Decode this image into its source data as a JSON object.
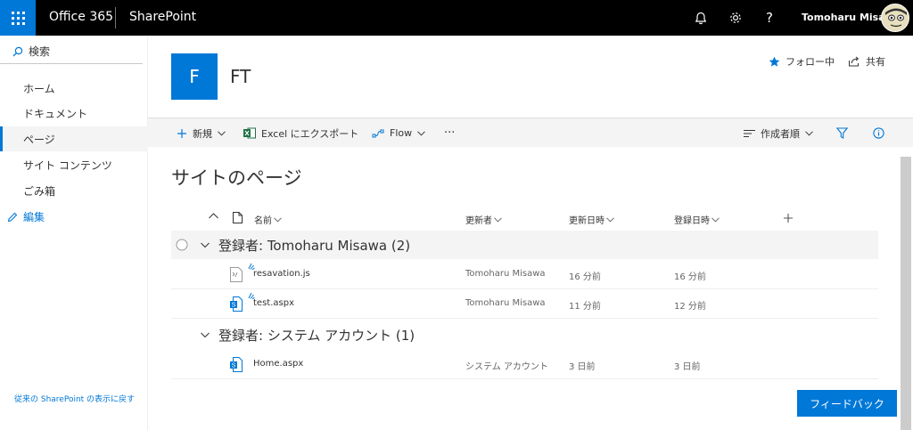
{
  "suite_bar": {
    "brand": "Office 365",
    "app_name": "SharePoint",
    "user_name": "Tomoharu Misawa"
  },
  "left_nav": {
    "search_label": "検索",
    "items": [
      {
        "label": "ホーム"
      },
      {
        "label": "ドキュメント"
      },
      {
        "label": "ページ"
      },
      {
        "label": "サイト コンテンツ"
      },
      {
        "label": "ごみ箱"
      }
    ],
    "edit_label": "編集",
    "classic_link": "従来の SharePoint の表示に戻す"
  },
  "site": {
    "logo_letter": "F",
    "title": "FT",
    "follow_label": "フォロー中",
    "share_label": "共有"
  },
  "command_bar": {
    "new_label": "新規",
    "export_label": "Excel にエクスポート",
    "flow_label": "Flow",
    "more_label": "···",
    "sort_label": "作成者順"
  },
  "main": {
    "heading": "サイトのページ",
    "columns": {
      "name": "名前",
      "modified_by": "更新者",
      "modified": "更新日時",
      "created": "登録日時"
    },
    "groups": [
      {
        "label": "登録者: Tomoharu Misawa (2)",
        "rows": [
          {
            "name": "resavation.js",
            "modified_by": "Tomoharu Misawa",
            "modified": "16 分前",
            "created": "16 分前"
          },
          {
            "name": "test.aspx",
            "modified_by": "Tomoharu Misawa",
            "modified": "11 分前",
            "created": "12 分前"
          }
        ]
      },
      {
        "label": "登録者: システム アカウント (1)",
        "rows": [
          {
            "name": "Home.aspx",
            "modified_by": "システム アカウント",
            "modified": "3 日前",
            "created": "3 日前"
          }
        ]
      }
    ]
  },
  "feedback_label": "フィードバック",
  "colors": {
    "accent": "#0078d7",
    "suite_bar": "#000000",
    "command_bar": "#f4f4f4"
  }
}
